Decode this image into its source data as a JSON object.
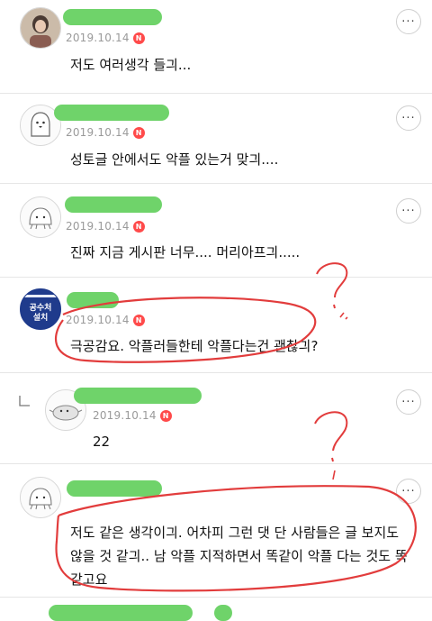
{
  "comments": [
    {
      "date": "2019.10.14",
      "badge": "N",
      "text": "저도 여러생각 들긔..."
    },
    {
      "date": "2019.10.14",
      "badge": "N",
      "text": "성토글 안에서도 악플 있는거 맞긔...."
    },
    {
      "date": "2019.10.14",
      "badge": "N",
      "text": "진짜 지금 게시판 너무.... 머리아프긔....."
    },
    {
      "date": "2019.10.14",
      "badge": "N",
      "text": "극공감요. 악플러들한테 악플다는건 괜찮긔?",
      "avatar_text": [
        "공수처",
        "설치"
      ]
    },
    {
      "date": "2019.10.14",
      "badge": "N",
      "text": "22",
      "reply": true
    },
    {
      "date": "2019.10.14",
      "badge": "N",
      "text_lines": [
        "저도 같은 생각이긔. 어차피 그런 댓 단 사람들은  글 보지도",
        "않을 것 같긔.. 남 악플 지적하면서 똑같이 악플 다는 것도 똑",
        "같고요"
      ]
    }
  ],
  "more_button_glyph": "···",
  "colors": {
    "name_blur": "#6fd36a",
    "annotation": "#e23c3c",
    "badge": "#ff4a4a"
  }
}
